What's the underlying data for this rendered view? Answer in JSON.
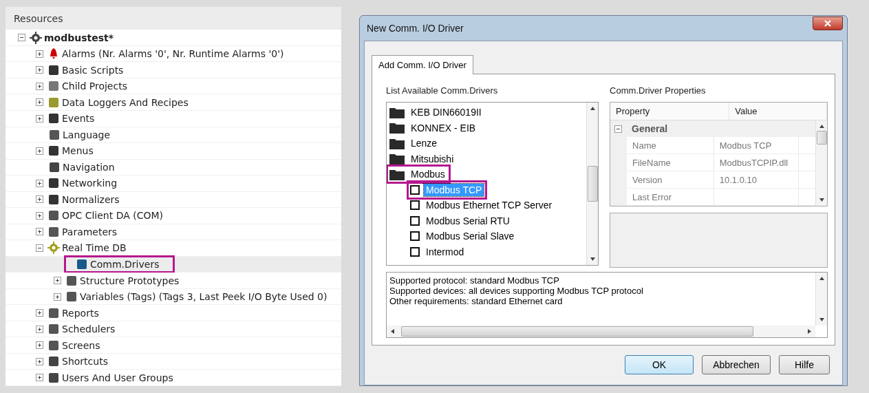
{
  "resources": {
    "title": "Resources",
    "tree": [
      {
        "label": "modbustest*",
        "bold": true,
        "expanded": true,
        "selected": false,
        "highlighted": false,
        "children": [
          {
            "label": "Alarms (Nr. Alarms '0', Nr. Runtime Alarms '0')",
            "expanded": false,
            "selected": false,
            "highlighted": false
          },
          {
            "label": "Basic Scripts",
            "expanded": false,
            "selected": false,
            "highlighted": false
          },
          {
            "label": "Child Projects",
            "expanded": false,
            "selected": false,
            "highlighted": false
          },
          {
            "label": "Data Loggers And Recipes",
            "expanded": false,
            "selected": false,
            "highlighted": false
          },
          {
            "label": "Events",
            "expanded": false,
            "selected": false,
            "highlighted": false
          },
          {
            "label": "Language",
            "selected": false,
            "highlighted": false
          },
          {
            "label": "Menus",
            "expanded": false,
            "selected": false,
            "highlighted": false
          },
          {
            "label": "Navigation",
            "selected": false,
            "highlighted": false
          },
          {
            "label": "Networking",
            "expanded": false,
            "selected": false,
            "highlighted": false
          },
          {
            "label": "Normalizers",
            "expanded": false,
            "selected": false,
            "highlighted": false
          },
          {
            "label": "OPC Client DA (COM)",
            "expanded": false,
            "selected": false,
            "highlighted": false
          },
          {
            "label": "Parameters",
            "expanded": false,
            "selected": false,
            "highlighted": false
          },
          {
            "label": "Real Time DB",
            "expanded": true,
            "selected": false,
            "highlighted": false,
            "children": [
              {
                "label": "Comm.Drivers",
                "selected": true,
                "highlighted": true
              },
              {
                "label": "Structure Prototypes",
                "expanded": false,
                "selected": false,
                "highlighted": false
              },
              {
                "label": "Variables (Tags) (Tags 3, Last Peek I/O Byte Used 0)",
                "expanded": false,
                "selected": false,
                "highlighted": false
              }
            ]
          },
          {
            "label": "Reports",
            "expanded": false,
            "selected": false,
            "highlighted": false
          },
          {
            "label": "Schedulers",
            "expanded": false,
            "selected": false,
            "highlighted": false
          },
          {
            "label": "Screens",
            "expanded": false,
            "selected": false,
            "highlighted": false
          },
          {
            "label": "Shortcuts",
            "expanded": false,
            "selected": false,
            "highlighted": false
          },
          {
            "label": "Users And User Groups",
            "expanded": false,
            "selected": false,
            "highlighted": false
          }
        ]
      }
    ]
  },
  "dialog": {
    "title": "New Comm. I/O Driver",
    "tabs": [
      {
        "label": "Add Comm. I/O Driver",
        "selected": true
      }
    ],
    "drivers_label": "List Available Comm.Drivers",
    "drivers": [
      {
        "kind": "folder",
        "label": "KEB DIN66019II",
        "selected": false,
        "highlighted": false
      },
      {
        "kind": "folder",
        "label": "KONNEX - EIB",
        "selected": false,
        "highlighted": false
      },
      {
        "kind": "folder",
        "label": "Lenze",
        "selected": false,
        "highlighted": false
      },
      {
        "kind": "folder",
        "label": "Mitsubishi",
        "selected": false,
        "highlighted": false
      },
      {
        "kind": "folder",
        "label": "Modbus",
        "selected": false,
        "highlighted": true
      },
      {
        "kind": "driver",
        "label": "Modbus TCP",
        "checked": false,
        "selected": true,
        "highlighted": true
      },
      {
        "kind": "driver",
        "label": "Modbus Ethernet TCP Server",
        "checked": false,
        "selected": false,
        "highlighted": false
      },
      {
        "kind": "driver",
        "label": "Modbus Serial RTU",
        "checked": false,
        "selected": false,
        "highlighted": false
      },
      {
        "kind": "driver",
        "label": "Modbus Serial Slave",
        "checked": false,
        "selected": false,
        "highlighted": false
      },
      {
        "kind": "driver",
        "label": "Intermod",
        "checked": false,
        "selected": false,
        "highlighted": false
      }
    ],
    "properties_label": "Comm.Driver Properties",
    "properties": {
      "columns": [
        "Property",
        "Value"
      ],
      "groups": [
        {
          "label": "General",
          "expanded": true,
          "rows": [
            {
              "property": "Name",
              "value": "Modbus TCP"
            },
            {
              "property": "FileName",
              "value": "ModbusTCPIP.dll"
            },
            {
              "property": "Version",
              "value": "10.1.0.10"
            },
            {
              "property": "Last Error"
            }
          ]
        }
      ]
    },
    "description": [
      "Supported protocol: standard Modbus TCP",
      "Supported devices: all devices supporting Modbus TCP protocol",
      "Other requirements: standard Ethernet card"
    ],
    "buttons": [
      {
        "label": "OK",
        "default": true
      },
      {
        "label": "Abbrechen",
        "default": false
      },
      {
        "label": "Hilfe",
        "default": false
      }
    ]
  }
}
